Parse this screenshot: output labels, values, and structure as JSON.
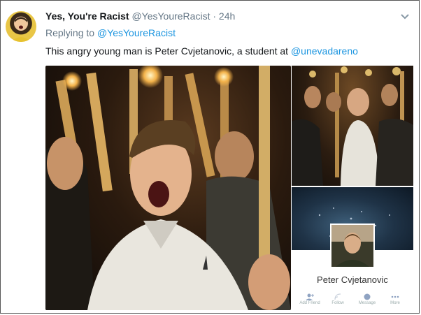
{
  "tweet": {
    "display_name": "Yes, You're Racist",
    "handle": "@YesYoureRacist",
    "separator": "·",
    "time": "24h",
    "reply_prefix": "Replying to",
    "reply_to": "@YesYoureRacist",
    "text_before": "This angry young man is Peter Cvjetanovic, a student at ",
    "mention": "@unevadareno"
  },
  "icons": {
    "avatar": "avatar",
    "chevron": "chevron-down-icon"
  },
  "media": {
    "profile_card": {
      "name": "Peter Cvjetanovic",
      "actions": [
        "Add Friend",
        "Follow",
        "Message",
        "More"
      ]
    }
  },
  "colors": {
    "link": "#1b95e0",
    "text": "#14171a",
    "muted": "#657786"
  }
}
